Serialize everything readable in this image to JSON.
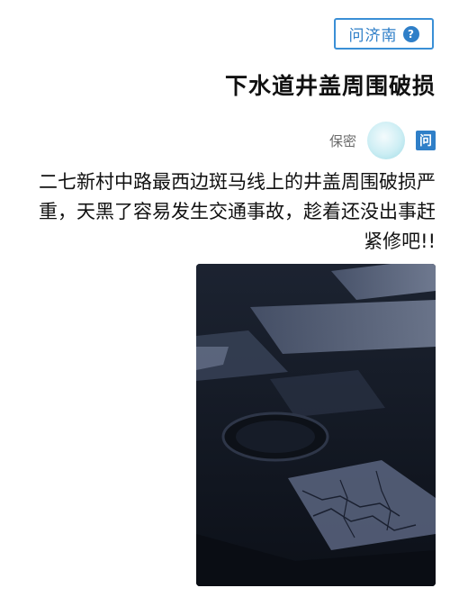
{
  "header": {
    "brand_label": "问济南",
    "brand_icon": "question-circle-icon"
  },
  "question": {
    "title": "下水道井盖周围破损",
    "author": "保密",
    "tag_label": "问",
    "body": "二七新村中路最西边斑马线上的井盖周围破损严重，天黑了容易发生交通事故，趁着还没出事赶紧修吧!!"
  },
  "photo": {
    "description_icon": "manhole-photo"
  },
  "colors": {
    "accent": "#2f7fc8",
    "text": "#111111",
    "muted": "#6b6b6b"
  }
}
